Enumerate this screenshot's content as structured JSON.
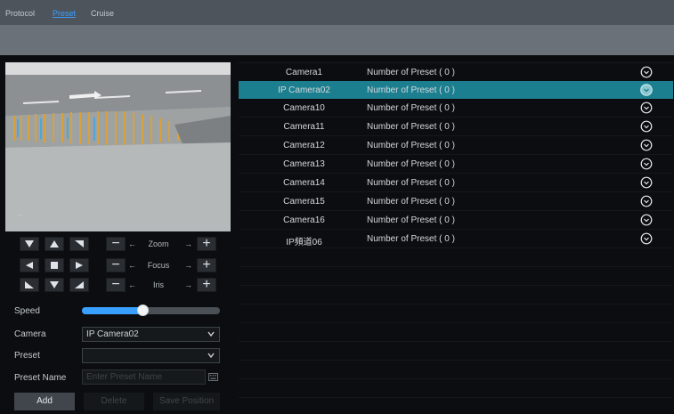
{
  "tabs": [
    {
      "label": "Protocol",
      "active": false
    },
    {
      "label": "Preset",
      "active": true
    },
    {
      "label": "Cruise",
      "active": false
    }
  ],
  "ptz": {
    "zoom_label": "Zoom",
    "focus_label": "Focus",
    "iris_label": "Iris",
    "arrow_left": "←",
    "arrow_right": "→"
  },
  "form": {
    "speed_label": "Speed",
    "speed_value_fraction": 0.44,
    "camera_label": "Camera",
    "camera_value": "IP Camera02",
    "preset_label": "Preset",
    "preset_value": "",
    "preset_name_label": "Preset Name",
    "preset_name_placeholder": "Enter Preset Name"
  },
  "buttons": {
    "add": "Add",
    "delete": "Delete",
    "save_position": "Save Position"
  },
  "cameras": [
    {
      "name": "Camera1",
      "presets": "Number of Preset ( 0 )",
      "selected": false
    },
    {
      "name": "IP Camera02",
      "presets": "Number of Preset ( 0 )",
      "selected": true
    },
    {
      "name": "Camera10",
      "presets": "Number of Preset ( 0 )",
      "selected": false
    },
    {
      "name": "Camera11",
      "presets": "Number of Preset ( 0 )",
      "selected": false
    },
    {
      "name": "Camera12",
      "presets": "Number of Preset ( 0 )",
      "selected": false
    },
    {
      "name": "Camera13",
      "presets": "Number of Preset ( 0 )",
      "selected": false
    },
    {
      "name": "Camera14",
      "presets": "Number of Preset ( 0 )",
      "selected": false
    },
    {
      "name": "Camera15",
      "presets": "Number of Preset ( 0 )",
      "selected": false
    },
    {
      "name": "Camera16",
      "presets": "Number of Preset ( 0 )",
      "selected": false
    },
    {
      "name": "IP頻道06",
      "presets": "Number of Preset ( 0 )",
      "selected": false
    }
  ],
  "colors": {
    "accent": "#3aa0ff",
    "selected_row": "#1c7f90"
  }
}
